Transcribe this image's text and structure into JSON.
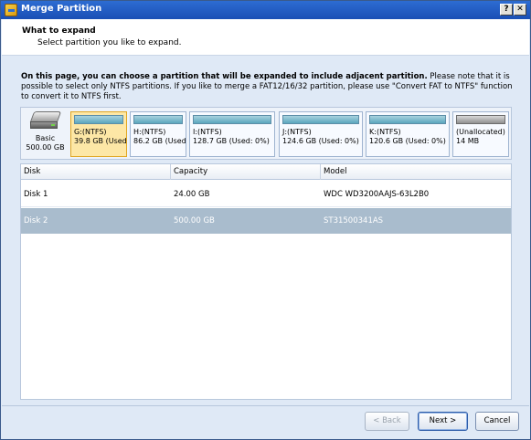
{
  "window": {
    "title": "Merge Partition",
    "help_label": "?",
    "close_label": "✕"
  },
  "header": {
    "title": "What to expand",
    "subtitle": "Select partition you like to expand."
  },
  "description": {
    "bold": "On this page, you can choose a partition that will be expanded to include adjacent partition.",
    "rest": " Please note that it is possible to select only NTFS partitions. If you like to merge a FAT12/16/32 partition, please use \"Convert FAT to NTFS\" function to convert it to NTFS first."
  },
  "disk_map": {
    "disk_label": "Basic",
    "disk_size": "500.00 GB",
    "partitions": [
      {
        "name": "G:(NTFS)",
        "info": "39.8 GB (Used",
        "selected": true
      },
      {
        "name": "H:(NTFS)",
        "info": "86.2 GB (Used",
        "selected": false
      },
      {
        "name": "I:(NTFS)",
        "info": "128.7 GB (Used: 0%)",
        "selected": false
      },
      {
        "name": "J:(NTFS)",
        "info": "124.6 GB (Used: 0%)",
        "selected": false
      },
      {
        "name": "K:(NTFS)",
        "info": "120.6 GB (Used: 0%)",
        "selected": false
      },
      {
        "name": "(Unallocated)",
        "info": "14 MB",
        "selected": false
      }
    ]
  },
  "table": {
    "columns": [
      "Disk",
      "Capacity",
      "Model"
    ],
    "rows": [
      {
        "disk": "Disk 1",
        "capacity": "24.00 GB",
        "model": "WDC WD3200AAJS-63L2B0"
      },
      {
        "disk": "Disk 2",
        "capacity": "500.00 GB",
        "model": "ST31500341AS"
      }
    ],
    "selected_row": 1
  },
  "buttons": {
    "back": "< Back",
    "next": "Next >",
    "cancel": "Cancel"
  },
  "colors": {
    "titlebar": "#1a4fb5",
    "selected_partition": "#fde7a6",
    "selected_row": "#a9bccd",
    "window_bg": "#dfe9f6"
  }
}
